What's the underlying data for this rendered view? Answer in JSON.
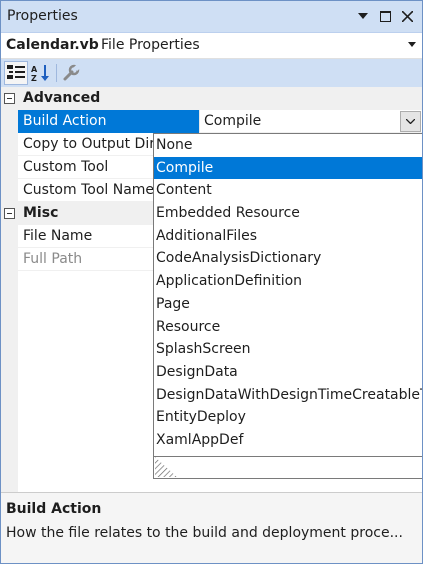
{
  "window": {
    "title": "Properties"
  },
  "object_selector": {
    "name": "Calendar.vb",
    "type": "File Properties"
  },
  "categories": [
    {
      "label": "Advanced",
      "properties": [
        {
          "name": "Build Action",
          "value": "Compile"
        },
        {
          "name": "Copy to Output Directory",
          "value": ""
        },
        {
          "name": "Custom Tool",
          "value": ""
        },
        {
          "name": "Custom Tool Namespace",
          "value": ""
        }
      ]
    },
    {
      "label": "Misc",
      "properties": [
        {
          "name": "File Name",
          "value": ""
        },
        {
          "name": "Full Path",
          "value": ""
        }
      ]
    }
  ],
  "dropdown": {
    "selected": "Compile",
    "options": [
      "None",
      "Compile",
      "Content",
      "Embedded Resource",
      "AdditionalFiles",
      "CodeAnalysisDictionary",
      "ApplicationDefinition",
      "Page",
      "Resource",
      "SplashScreen",
      "DesignData",
      "DesignDataWithDesignTimeCreatableTypes",
      "EntityDeploy",
      "XamlAppDef"
    ]
  },
  "description": {
    "title": "Build Action",
    "text": "How the file relates to the build and deployment proce..."
  },
  "colors": {
    "accent": "#0078d7",
    "titlebar": "#cfdff4"
  }
}
